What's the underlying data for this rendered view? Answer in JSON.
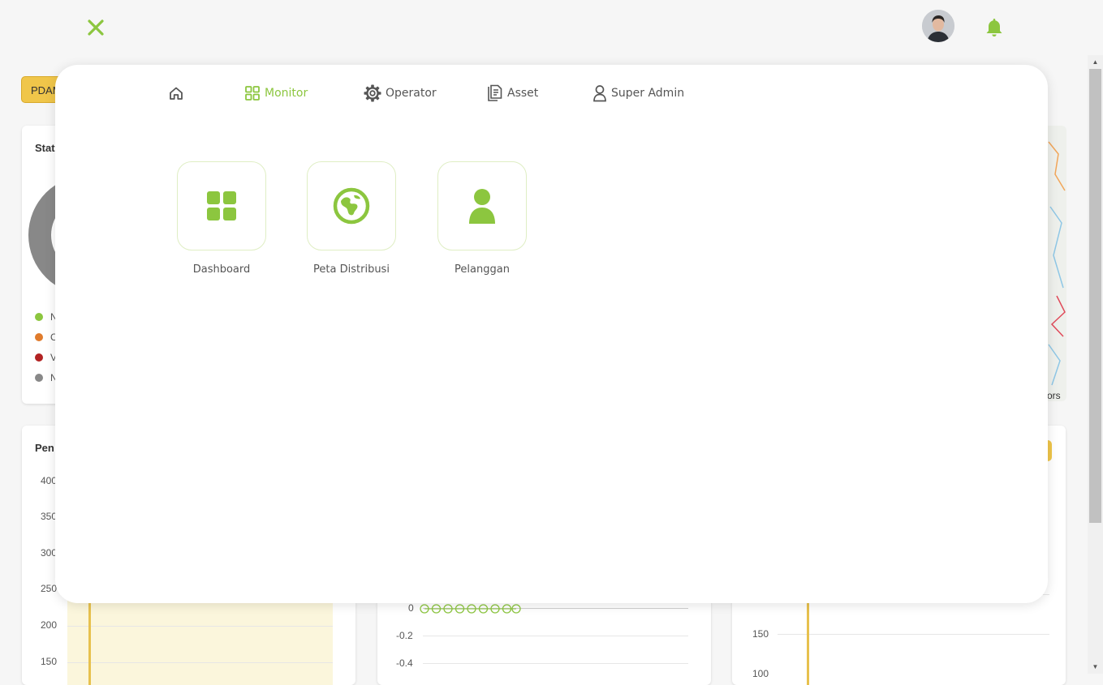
{
  "topbar": {
    "close_icon": "close-icon",
    "avatar_icon": "user-avatar",
    "bell_icon": "bell-icon",
    "accent": "#8cc63f"
  },
  "background": {
    "badge": "PDAM",
    "status_card_title": "Stat",
    "legend": [
      {
        "initial": "N",
        "color": "#8cc63f"
      },
      {
        "initial": "C",
        "color": "#e07b2c"
      },
      {
        "initial": "V",
        "color": "#b22222"
      },
      {
        "initial": "N",
        "color": "#888888"
      }
    ],
    "chart1": {
      "title": "Pen",
      "y_ticks": [
        "400",
        "350",
        "300",
        "250",
        "200",
        "150"
      ]
    },
    "chart2": {
      "y_ticks": [
        "0",
        "-0.2",
        "-0.4"
      ]
    },
    "chart3": {
      "y_ticks": [
        "150",
        "100"
      ]
    },
    "map_attribution": "ors"
  },
  "modal": {
    "nav": [
      {
        "label": "",
        "icon": "home-icon"
      },
      {
        "label": "Monitor",
        "icon": "grid-icon",
        "active": true
      },
      {
        "label": "Operator",
        "icon": "gear-icon"
      },
      {
        "label": "Asset",
        "icon": "document-icon"
      },
      {
        "label": "Super Admin",
        "icon": "user-icon"
      }
    ],
    "tiles": [
      {
        "label": "Dashboard",
        "icon": "dashboard-icon"
      },
      {
        "label": "Peta Distribusi",
        "icon": "globe-icon"
      },
      {
        "label": "Pelanggan",
        "icon": "user-icon"
      }
    ]
  }
}
